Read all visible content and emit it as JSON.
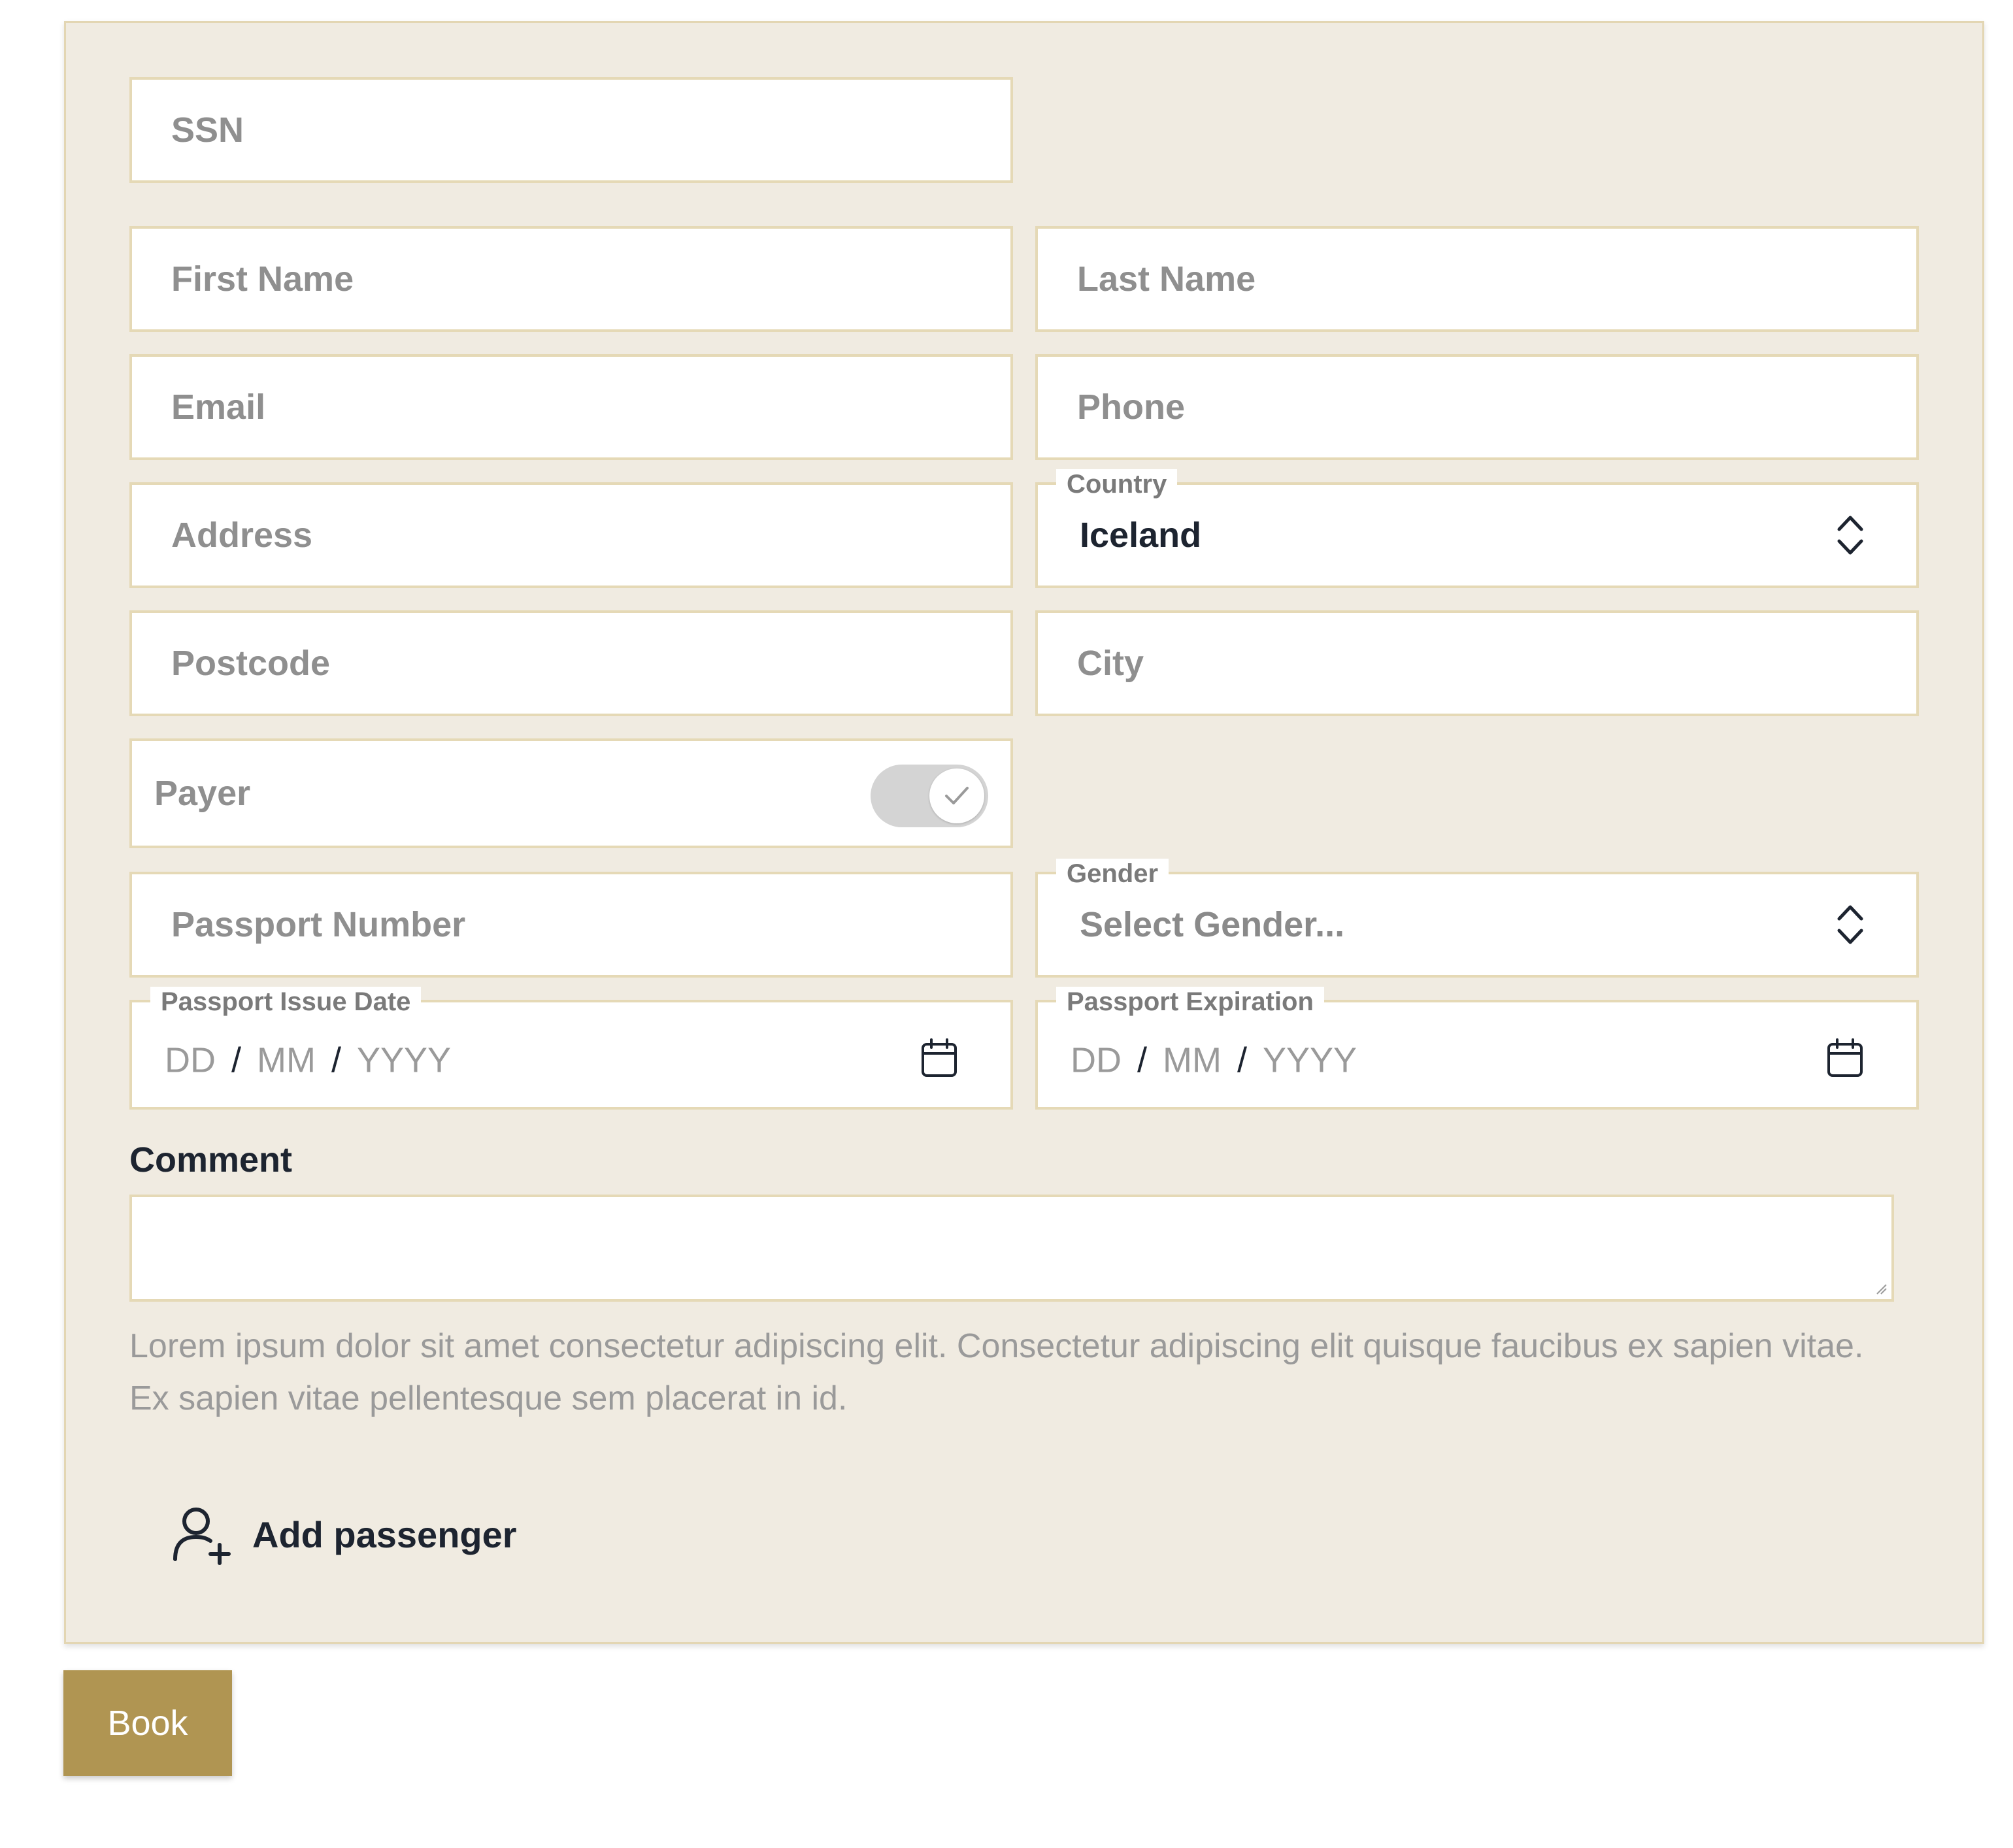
{
  "form": {
    "ssn_placeholder": "SSN",
    "first_name_placeholder": "First Name",
    "last_name_placeholder": "Last Name",
    "email_placeholder": "Email",
    "phone_placeholder": "Phone",
    "address_placeholder": "Address",
    "country": {
      "label": "Country",
      "value": "Iceland"
    },
    "postcode_placeholder": "Postcode",
    "city_placeholder": "City",
    "payer": {
      "label": "Payer",
      "checked": true
    },
    "passport_number_placeholder": "Passport Number",
    "gender": {
      "label": "Gender",
      "placeholder": "Select Gender..."
    },
    "passport_issue_date": {
      "label": "Passport Issue Date",
      "dd": "DD",
      "mm": "MM",
      "yyyy": "YYYY",
      "sep": "/"
    },
    "passport_expiration": {
      "label": "Passport Expiration",
      "dd": "DD",
      "mm": "MM",
      "yyyy": "YYYY",
      "sep": "/"
    },
    "comment": {
      "label": "Comment",
      "help_text": "Lorem ipsum dolor sit amet consectetur adipiscing elit. Consectetur adipiscing elit quisque faucibus ex sapien vitae. Ex sapien vitae pellentesque sem placerat in id."
    },
    "add_passenger_label": "Add passenger"
  },
  "book_button_label": "Book",
  "icons": {
    "country_select": "chevron-up-down-icon",
    "gender_select": "chevron-up-down-icon",
    "date_picker": "calendar-icon",
    "add_passenger": "user-plus-icon",
    "toggle_check": "check-icon"
  },
  "colors": {
    "panel_background": "#f0ebe1",
    "field_border": "#e5d9b6",
    "button_gold": "#b09552",
    "text_dark": "#1d2430",
    "placeholder_gray": "#8f8f8f"
  }
}
